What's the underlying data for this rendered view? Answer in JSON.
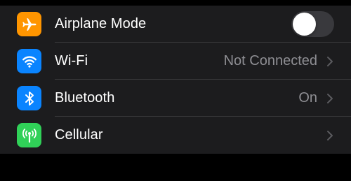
{
  "colors": {
    "background": "#000000",
    "group_background": "#1c1c1e",
    "separator": "#38383a",
    "label_text": "#ffffff",
    "value_text": "#8e8e93",
    "toggle_off": "#39393d"
  },
  "settings": {
    "rows": [
      {
        "label": "Airplane Mode",
        "icon": "airplane-icon",
        "icon_color": "#ff9500",
        "control": "toggle",
        "toggle_on": false
      },
      {
        "label": "Wi-Fi",
        "icon": "wifi-icon",
        "icon_color": "#0a84ff",
        "control": "disclosure",
        "value": "Not Connected"
      },
      {
        "label": "Bluetooth",
        "icon": "bluetooth-icon",
        "icon_color": "#0a84ff",
        "control": "disclosure",
        "value": "On"
      },
      {
        "label": "Cellular",
        "icon": "cellular-icon",
        "icon_color": "#30d158",
        "control": "disclosure",
        "value": ""
      }
    ]
  }
}
